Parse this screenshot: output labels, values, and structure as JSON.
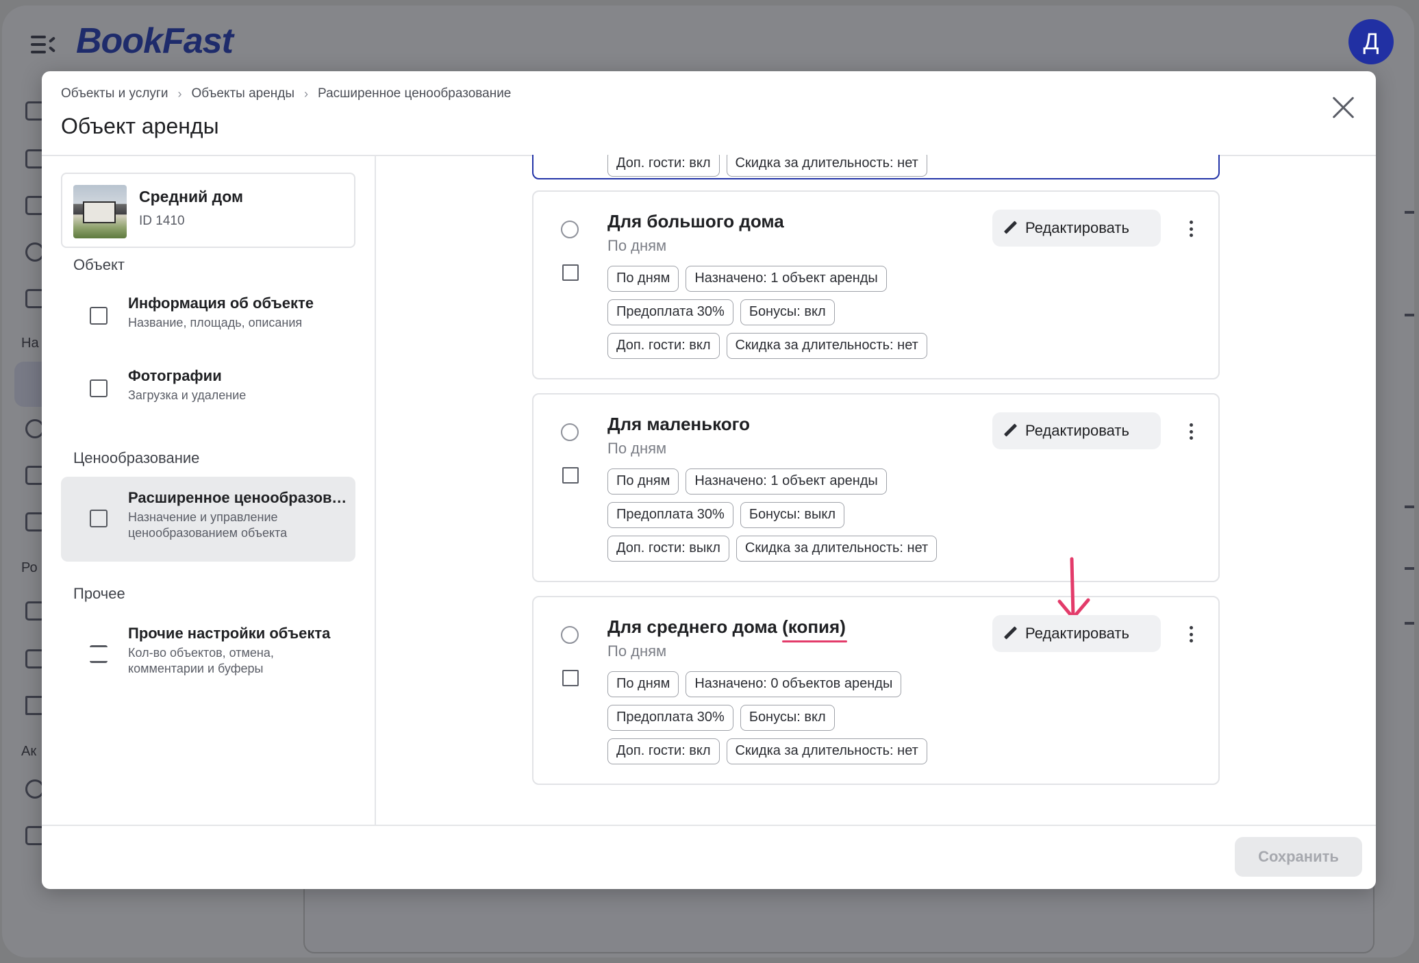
{
  "app": {
    "logo": "BookFast",
    "avatar_letter": "Д",
    "nav_section_labels": [
      "На",
      "Ро",
      "Ак"
    ]
  },
  "modal": {
    "breadcrumbs": [
      "Объекты и услуги",
      "Объекты аренды",
      "Расширенное ценообразование"
    ],
    "title": "Объект аренды",
    "object": {
      "name": "Средний дом",
      "id": "ID 1410"
    },
    "sections": {
      "object": "Объект",
      "pricing": "Ценообразование",
      "other": "Прочее"
    },
    "nav": {
      "info": {
        "title": "Информация об объекте",
        "subtitle": "Название, площадь, описания",
        "icon": "image-icon"
      },
      "photos": {
        "title": "Фотографии",
        "subtitle": "Загрузка и удаление",
        "icon": "image-icon"
      },
      "pricing": {
        "title": "Расширенное ценообразование",
        "subtitle": "Назначение и управление ценообразованием объекта",
        "icon": "price-tag-icon"
      },
      "other": {
        "title": "Прочие настройки объекта",
        "subtitle": "Кол-во объектов, отмена, комментарии и буферы",
        "icon": "sliders-icon"
      }
    },
    "top_partial_chips": [
      "Доп. гости: вкл",
      "Скидка за длительность: нет"
    ],
    "plans": [
      {
        "name": "Для большого дома",
        "name_extra": "",
        "subtitle": "По дням",
        "chips": [
          [
            "По дням",
            "Назначено: 1 объект аренды"
          ],
          [
            "Предоплата 30%",
            "Бонусы: вкл"
          ],
          [
            "Доп. гости: вкл",
            "Скидка за длительность: нет"
          ]
        ]
      },
      {
        "name": "Для маленького",
        "name_extra": "",
        "subtitle": "По дням",
        "chips": [
          [
            "По дням",
            "Назначено: 1 объект аренды"
          ],
          [
            "Предоплата 30%",
            "Бонусы: выкл"
          ],
          [
            "Доп. гости: выкл",
            "Скидка за длительность: нет"
          ]
        ]
      },
      {
        "name": "Для среднего дома",
        "name_extra": "(копия)",
        "subtitle": "По дням",
        "chips": [
          [
            "По дням",
            "Назначено: 0 объектов аренды"
          ],
          [
            "Предоплата 30%",
            "Бонусы: вкл"
          ],
          [
            "Доп. гости: вкл",
            "Скидка за длительность: нет"
          ]
        ]
      }
    ],
    "edit_label": "Редактировать",
    "save_label": "Сохранить",
    "colors": {
      "accent": "#2334a8",
      "highlight": "#e33b6a",
      "disabled": "#a6a8ae"
    }
  }
}
